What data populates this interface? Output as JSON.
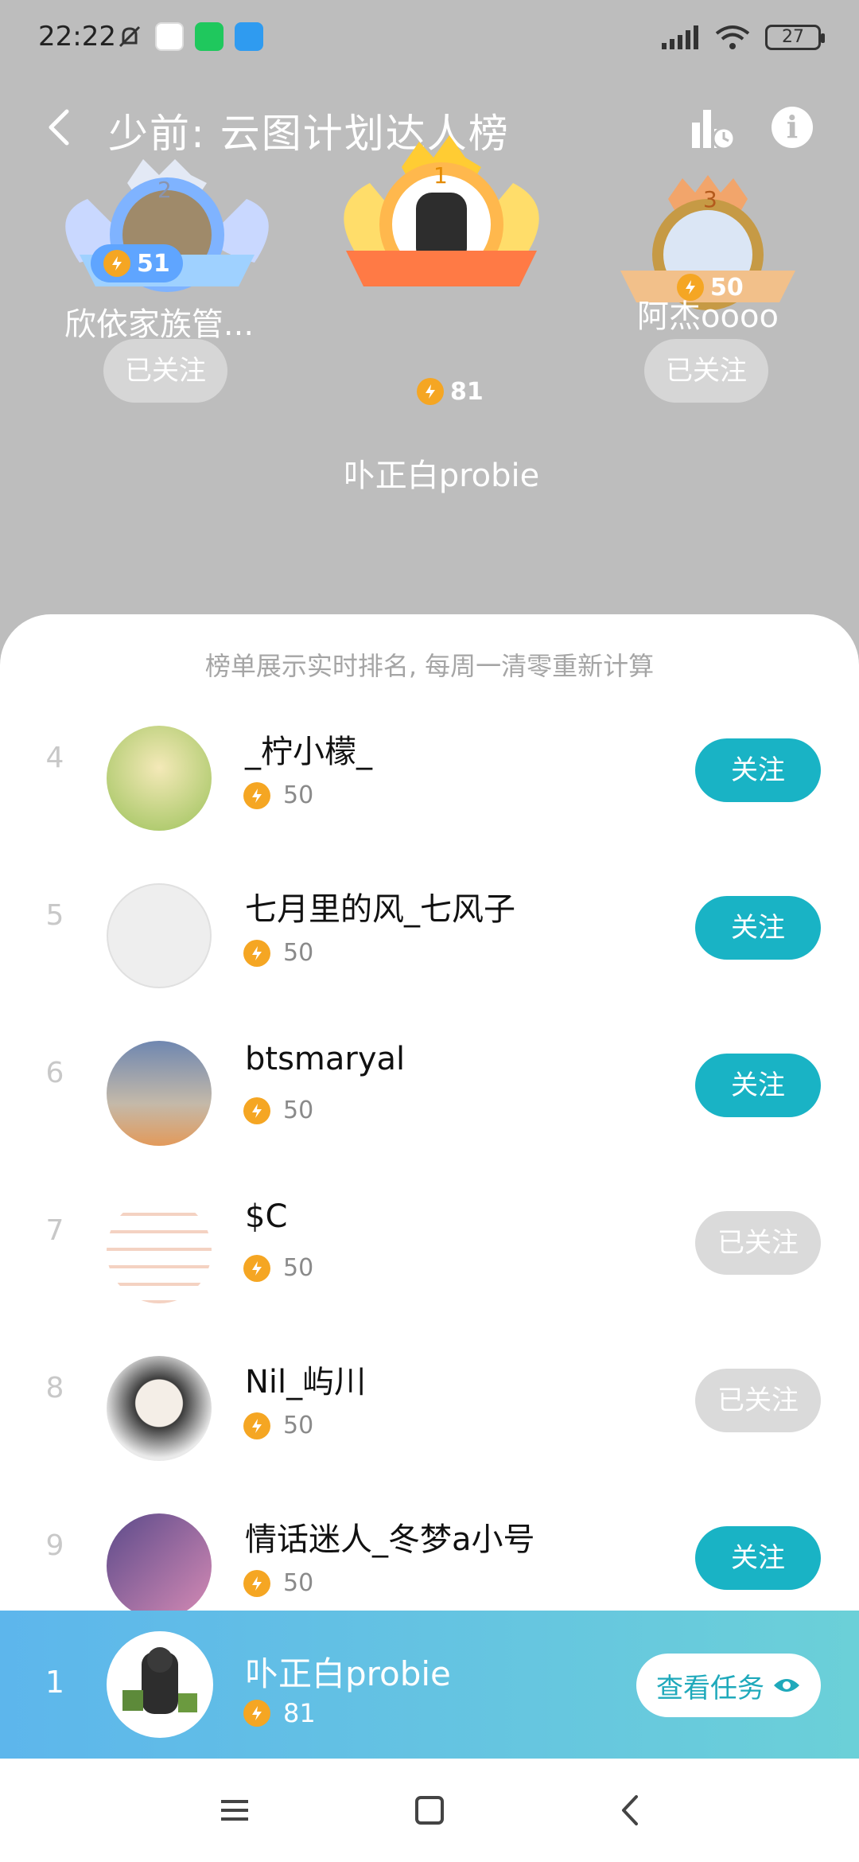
{
  "status": {
    "time": "22:22",
    "battery": "27",
    "app_icon_colors": [
      "#ffffff",
      "#1fc85d",
      "#2f9bf0"
    ]
  },
  "header": {
    "title": "少前: 云图计划达人榜",
    "back_icon": "chevron-left-icon",
    "stats_icon": "chart-clock-icon",
    "info_icon": "info-icon"
  },
  "podium": {
    "first": {
      "rank": "1",
      "name": "卟正白probie",
      "score": "81"
    },
    "second": {
      "rank": "2",
      "name": "欣依家族管...",
      "score": "51",
      "follow_label": "已关注"
    },
    "third": {
      "rank": "3",
      "name": "阿杰oooo",
      "score": "50",
      "follow_label": "已关注"
    }
  },
  "list": {
    "notice": "榜单展示实时排名, 每周一清零重新计算",
    "rows": [
      {
        "rank": "4",
        "name": "_柠小檬_",
        "score": "50",
        "button": "关注",
        "followed": false
      },
      {
        "rank": "5",
        "name": "七月里的风_七风子",
        "score": "50",
        "button": "关注",
        "followed": false
      },
      {
        "rank": "6",
        "name": "btsmaryal",
        "score": "50",
        "button": "关注",
        "followed": false
      },
      {
        "rank": "7",
        "name": "$C",
        "score": "50",
        "button": "已关注",
        "followed": true
      },
      {
        "rank": "8",
        "name": "Nil_屿川",
        "score": "50",
        "button": "已关注",
        "followed": true
      },
      {
        "rank": "9",
        "name": "情话迷人_冬梦a小号",
        "score": "50",
        "button": "关注",
        "followed": false
      }
    ]
  },
  "me": {
    "rank": "1",
    "name": "卟正白probie",
    "score": "81",
    "task_button": "查看任务"
  },
  "nav": {
    "menu_icon": "menu-icon",
    "home_icon": "home-square-icon",
    "back_icon": "back-triangle-icon"
  },
  "colors": {
    "accent": "#19b3c5",
    "followed": "#dadada",
    "score_icon": "#f5a623",
    "background": "#bdbdbd"
  }
}
